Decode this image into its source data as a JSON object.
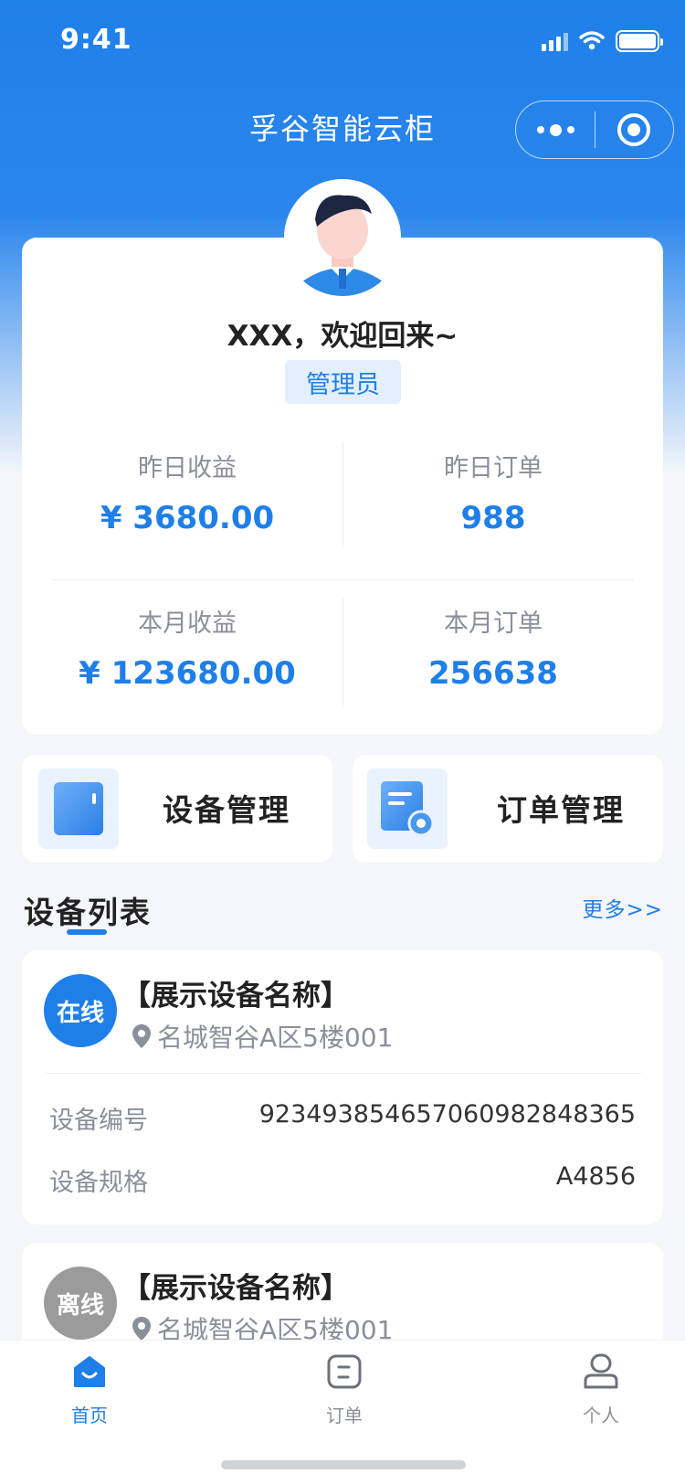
{
  "status_bar": {
    "time": "9:41"
  },
  "header": {
    "title": "孚谷智能云柜"
  },
  "profile": {
    "greeting": "XXX，欢迎回来~",
    "role": "管理员",
    "stats": {
      "yesterday_income_label": "昨日收益",
      "yesterday_income_value": "¥ 3680.00",
      "yesterday_orders_label": "昨日订单",
      "yesterday_orders_value": "988",
      "month_income_label": "本月收益",
      "month_income_value": "¥ 123680.00",
      "month_orders_label": "本月订单",
      "month_orders_value": "256638"
    }
  },
  "quick_actions": [
    {
      "label": "设备管理",
      "icon": "device-icon"
    },
    {
      "label": "订单管理",
      "icon": "order-settings-icon"
    }
  ],
  "device_list": {
    "title": "设备列表",
    "more": "更多>>",
    "items": [
      {
        "status": "在线",
        "name": "【展示设备名称】",
        "location": "名城智谷A区5楼001",
        "serial_label": "设备编号",
        "serial": "92349385465706098​2848365",
        "spec_label": "设备规格",
        "spec": "A4856"
      },
      {
        "status": "离线",
        "name": "【展示设备名称】",
        "location": "名城智谷A区5楼001"
      }
    ]
  },
  "tabbar": [
    {
      "label": "首页",
      "icon": "home-icon",
      "active": true
    },
    {
      "label": "订单",
      "icon": "order-icon",
      "active": false
    },
    {
      "label": "个人",
      "icon": "person-icon",
      "active": false
    }
  ],
  "colors": {
    "primary": "#1f7fe9",
    "online": "#1f7fe9",
    "offline": "#9b9b9b",
    "inactive_tab": "#8a8f99"
  }
}
